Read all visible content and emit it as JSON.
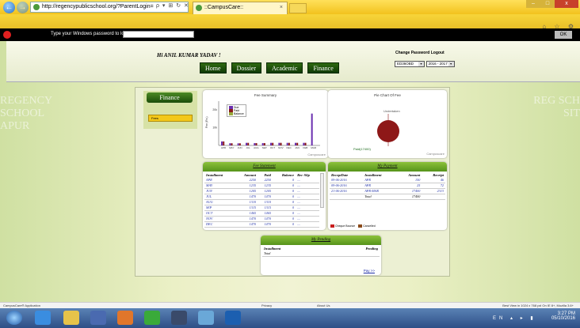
{
  "browser": {
    "url": "http://regencypublicschool.org/?ParentLogin=",
    "addr_controls": "ρ ▾ ⊞ ↻ ✕",
    "tab_title": "::CampusCare::",
    "win_min": "–",
    "win_max": "□",
    "win_close": "x",
    "chrome_icons": "⌂ ☆ ⚙"
  },
  "pw_bar": {
    "label": "Type your Windows password to log on:",
    "ok": "OK"
  },
  "header": {
    "welcome": "Hi ANIL KUMAR YADAV !",
    "account_links": "Change Password Logout",
    "student_select": "ED36OBD",
    "session_select": "2016 - 2017",
    "menu": [
      "Home",
      "Dossier",
      "Academic",
      "Finance"
    ]
  },
  "watermark": {
    "left": "REGENCY SCHOOL APUR",
    "right": "REG SCH SIT"
  },
  "sidebar": {
    "title": "Finance",
    "select": "Fees"
  },
  "fee_summary": {
    "title": "Fee Summary",
    "legend": [
      {
        "name": "Due",
        "color": "#6a2fb0"
      },
      {
        "name": "Paid",
        "color": "#8a1a1a"
      },
      {
        "name": "Balance",
        "color": "#98a83a"
      }
    ],
    "y_label": "Fee (Rs.)",
    "y_ticks": [
      "20k",
      "10k",
      "0"
    ],
    "watermark": "Campuscare"
  },
  "chart_data": {
    "type": "bar",
    "title": "Fee Summary",
    "ylabel": "Fee (Rs.)",
    "categories": [
      "APR",
      "MAY",
      "JUN",
      "JUL",
      "AUG",
      "SEP",
      "OCT",
      "NOV",
      "DEC",
      "JAN",
      "FEB",
      "MAR"
    ],
    "series": [
      {
        "name": "Due",
        "values": [
          2250,
          1235,
          1205,
          1470,
          1310,
          1315,
          1465,
          1470,
          1470,
          1470,
          1470,
          18000
        ]
      },
      {
        "name": "Paid",
        "values": [
          2250,
          1235,
          1205,
          1470,
          1310,
          1315,
          1465,
          1470,
          1470,
          1470,
          1470,
          0
        ]
      },
      {
        "name": "Balance",
        "values": [
          0,
          0,
          0,
          0,
          0,
          0,
          0,
          0,
          0,
          0,
          0,
          0
        ]
      }
    ],
    "ylim": [
      0,
      25000
    ]
  },
  "pie": {
    "title": "Pie Chart Of Fee",
    "labels": [
      "Undertaken",
      "Paid(17400)"
    ],
    "color": "#8e1818",
    "watermark": "Campuscare"
  },
  "fee_statement": {
    "title": "Fee Statement",
    "columns": [
      "Installment",
      "Amount",
      "Paid",
      "Balance",
      "Rec-Slip"
    ],
    "rows": [
      [
        "APR",
        "2250",
        "2250",
        "0",
        "...."
      ],
      [
        "MAY",
        "1235",
        "1235",
        "0",
        "...."
      ],
      [
        "JUN",
        "1205",
        "1205",
        "0",
        "...."
      ],
      [
        "JUL",
        "1470",
        "1470",
        "0",
        "...."
      ],
      [
        "AUG",
        "1310",
        "1310",
        "0",
        "...."
      ],
      [
        "SEP",
        "1315",
        "1315",
        "0",
        "...."
      ],
      [
        "OCT",
        "1465",
        "1465",
        "0",
        "...."
      ],
      [
        "NOV",
        "1470",
        "1470",
        "0",
        "...."
      ],
      [
        "DEC",
        "1470",
        "1470",
        "0",
        "...."
      ]
    ]
  },
  "payment": {
    "title": "My Payment",
    "columns": [
      "ReceptDate",
      "Installment",
      "Amount",
      "Receipt"
    ],
    "rows": [
      [
        "09-06-2016",
        "APR",
        "150",
        "46"
      ],
      [
        "09-06-2016",
        "APR",
        "25",
        "72"
      ],
      [
        "21-06-2016",
        "APR-MAR",
        "17400",
        "2313"
      ]
    ],
    "total_label": "Total",
    "total": "17400",
    "legend": [
      "Cheque Bounce",
      "Cancelled"
    ]
  },
  "pending": {
    "title": "My Pending",
    "columns": [
      "Installment",
      "Pending"
    ],
    "total_label": "Total",
    "pay_link": "Pay >>"
  },
  "footer": {
    "left": "CampusCare® Application",
    "privacy": "Privacy",
    "about": "About Us",
    "best_view": "Best View in 1024 x 768 pxl On IE 8+, Mozilla 3.6+"
  },
  "taskbar": {
    "lang": "EN",
    "time": "3:27 PM",
    "date": "05/10/2016"
  }
}
